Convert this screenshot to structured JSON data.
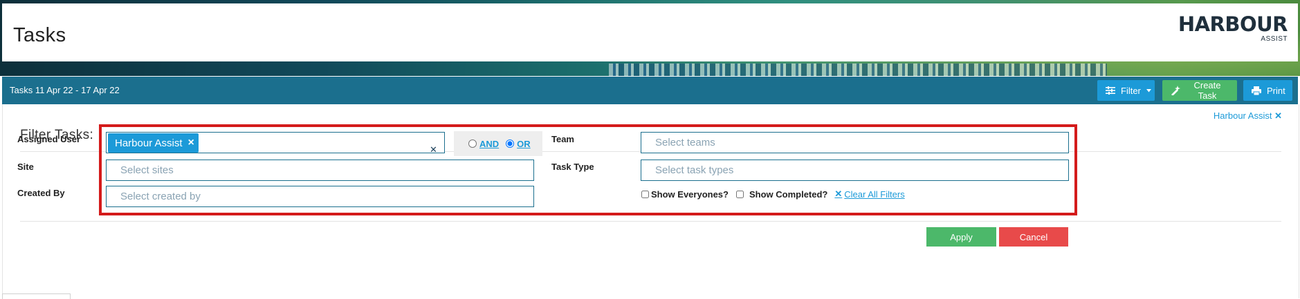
{
  "header": {
    "title": "Tasks",
    "logo_main": "HARBOUR",
    "logo_sub": "ASSIST"
  },
  "toolbar": {
    "date_range": "Tasks 11 Apr 22 - 17 Apr 22",
    "filter_label": "Filter",
    "create_label": "Create Task",
    "print_label": "Print"
  },
  "filter": {
    "user_link": "Harbour Assist",
    "heading": "Filter Tasks:",
    "assigned_user_label": "Assigned User",
    "assigned_user_chip": "Harbour Assist",
    "and_label": "AND",
    "or_label": "OR",
    "team_label": "Team",
    "team_placeholder": "Select teams",
    "site_label": "Site",
    "site_placeholder": "Select sites",
    "task_type_label": "Task Type",
    "task_type_placeholder": "Select task types",
    "created_by_label": "Created By",
    "created_by_placeholder": "Select created by",
    "show_everyones_label": "Show Everyones?",
    "show_completed_label": "Show Completed?",
    "clear_all_label": "Clear All Filters",
    "selected_logic": "OR"
  },
  "actions": {
    "apply_label": "Apply",
    "cancel_label": "Cancel"
  },
  "colors": {
    "toolbar": "#1b6f8e",
    "primary": "#1c9ad8",
    "success": "#4cb86a",
    "danger": "#e84a4a",
    "highlight": "#d41b1b"
  }
}
